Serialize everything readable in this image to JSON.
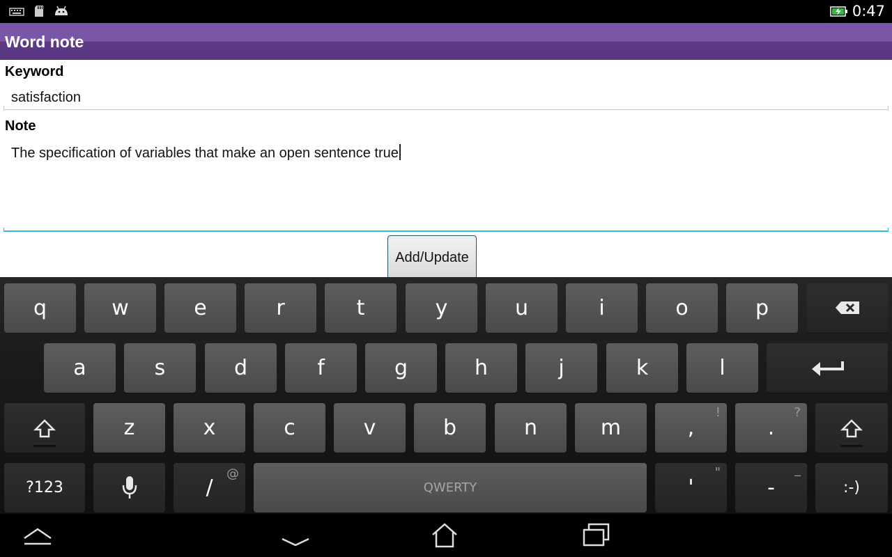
{
  "status_bar": {
    "time": "0:47",
    "icons": [
      "keyboard-icon",
      "sd-card-icon",
      "android-icon",
      "battery-charging-icon"
    ]
  },
  "app": {
    "title": "Word note"
  },
  "form": {
    "keyword_label": "Keyword",
    "keyword_value": "satisfaction",
    "note_label": "Note",
    "note_value": "The specification of variables that make an open sentence true",
    "submit_label": "Add/Update"
  },
  "keyboard": {
    "row1": [
      "q",
      "w",
      "e",
      "r",
      "t",
      "y",
      "u",
      "i",
      "o",
      "p"
    ],
    "row2": [
      "a",
      "s",
      "d",
      "f",
      "g",
      "h",
      "j",
      "k",
      "l"
    ],
    "row3": [
      "z",
      "x",
      "c",
      "v",
      "b",
      "n",
      "m",
      ",",
      "."
    ],
    "row3_hints": {
      ",": "!",
      ".": "?"
    },
    "symbols_key": "?123",
    "slash_key": "/",
    "slash_hint": "@",
    "space_label": "QWERTY",
    "apostrophe_key": "'",
    "apostrophe_hint": "\"",
    "dash_key": "-",
    "dash_hint": "_",
    "smiley_key": ":-)",
    "keys_with_more": "..."
  },
  "colors": {
    "titlebar": "#7a56a6",
    "focus_line": "#33b5e5"
  }
}
